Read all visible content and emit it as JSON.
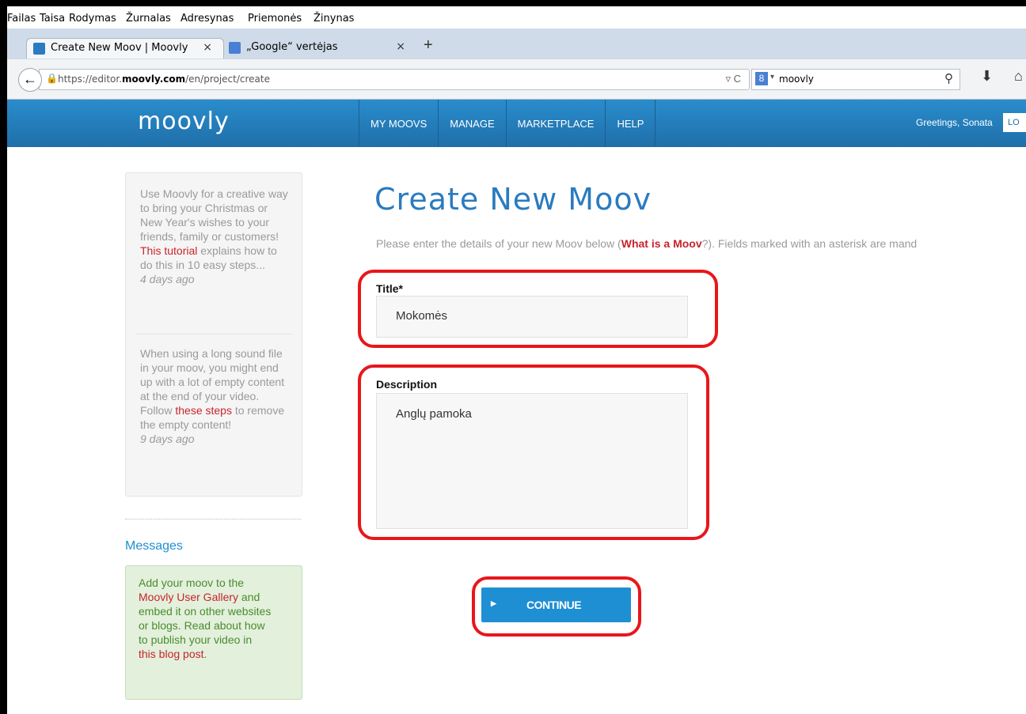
{
  "browser": {
    "menu": [
      "Failas",
      "Taisa",
      "Rodymas",
      "Žurnalas",
      "Adresynas",
      "Priemonės",
      "Žinynas"
    ],
    "tabs": [
      {
        "title": "Create New Moov | Moovly",
        "close": "×"
      },
      {
        "title": "„Google“ vertėjas",
        "close": "×"
      }
    ],
    "new_tab": "+",
    "url_prefix": "https://editor.",
    "url_domain": "moovly.com",
    "url_path": "/en/project/create",
    "search_query": "moovly"
  },
  "site": {
    "logo": "moovly",
    "nav": [
      "MY MOOVS",
      "MANAGE",
      "MARKETPLACE",
      "HELP"
    ],
    "greeting": "Greetings, Sonata",
    "login_btn": "LO"
  },
  "sidebar": {
    "news1": {
      "text_a": "Use Moovly for a creative way to bring your Christmas or New Year's wishes to your friends, family or customers! ",
      "link": "This tutorial",
      "text_b": " explains how to do this in 10 easy steps...",
      "time": "4 days ago"
    },
    "news2": {
      "text_a": "When using a long sound file in your moov, you might end up with a lot of empty content at the end of your video. Follow ",
      "link": "these steps",
      "text_b": " to remove the empty content!",
      "time": "9 days ago"
    },
    "messages_title": "Messages",
    "message": {
      "text_a": "Add your moov to the ",
      "link1": "Moovly User Gallery",
      "text_b": " and embed it on other websites or blogs. Read about how to publish your video in ",
      "link2": "this blog post",
      "text_c": "."
    }
  },
  "form": {
    "title": "Create New Moov",
    "intro_a": "Please enter the details of your new Moov below (",
    "intro_link": "What is a Moov",
    "intro_b": "?). Fields marked with an asterisk are mand",
    "title_label": "Title*",
    "title_value": "Mokomės",
    "description_label": "Description",
    "description_value": "Anglų pamoka",
    "continue": "CONTINUE"
  },
  "colors": {
    "header_blue": "#1f6fa8",
    "title_blue": "#2a7bbf",
    "link_red": "#c8242c",
    "button_blue": "#1e8fd3",
    "highlight_red": "#e8161b"
  }
}
